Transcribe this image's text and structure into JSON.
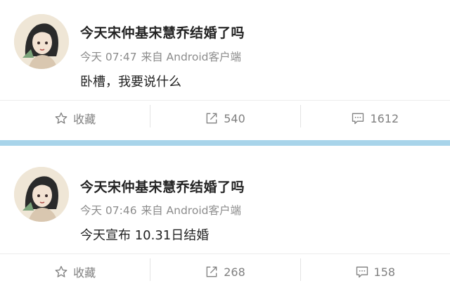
{
  "posts": [
    {
      "author": "今天宋仲基宋慧乔结婚了吗",
      "time": "今天 07:47",
      "source": "来自 Android客户端",
      "text": "卧槽，我要说什么",
      "actions": {
        "favorite": "收藏",
        "repost": "540",
        "comment": "1612"
      }
    },
    {
      "author": "今天宋仲基宋慧乔结婚了吗",
      "time": "今天 07:46",
      "source": "来自 Android客户端",
      "text": "今天宣布 10.31日结婚",
      "actions": {
        "favorite": "收藏",
        "repost": "268",
        "comment": "158"
      }
    }
  ],
  "icons": {
    "favorite": "star-outline-icon",
    "repost": "share-arrow-icon",
    "comment": "comment-bubble-icon"
  },
  "colors": {
    "separator_band": "#a8d4ea",
    "meta_text": "#8c8c8c",
    "action_text": "#808080"
  }
}
